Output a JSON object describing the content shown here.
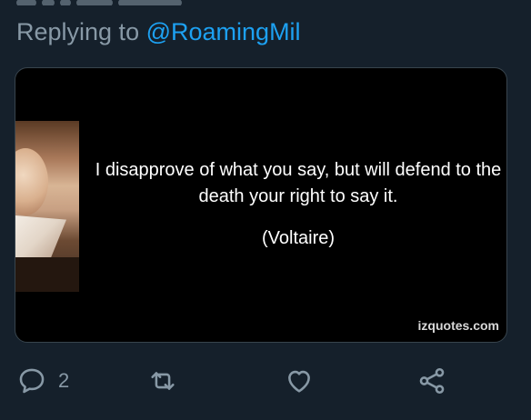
{
  "reply": {
    "prefix": "Replying to",
    "handle": "@RoamingMil"
  },
  "media": {
    "quote_text": "I disapprove of what you say, but will defend to the death your right to say it.",
    "author": "(Voltaire)",
    "watermark": "izquotes.com"
  },
  "actions": {
    "reply_count": "2",
    "icons": [
      "reply-icon",
      "retweet-icon",
      "like-icon",
      "share-icon"
    ]
  },
  "colors": {
    "background": "#15202b",
    "muted": "#8899a6",
    "link": "#1da1f2"
  }
}
